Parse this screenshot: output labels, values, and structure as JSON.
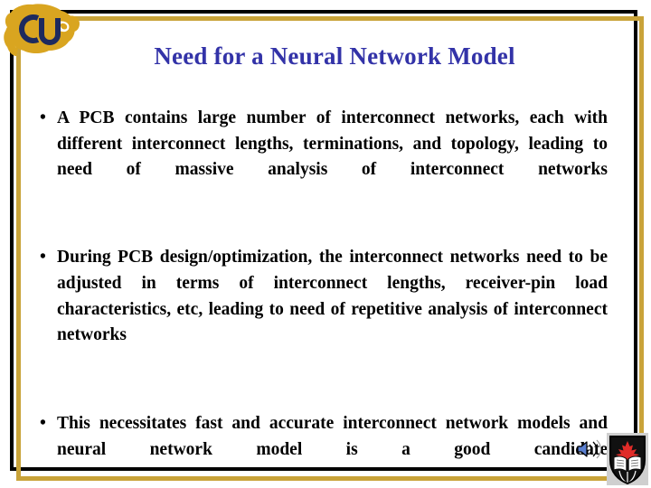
{
  "slide": {
    "title": "Need for a Neural Network Model",
    "title_color": "#3333a8",
    "background_color": "#ffffff",
    "frame_outer_color": "#000000",
    "frame_inner_color": "#c9a339",
    "body_text_color": "#000000",
    "bullet_marker": "•",
    "bullets": [
      "A PCB contains large number of interconnect networks, each with different interconnect lengths, terminations, and topology, leading to need of massive analysis of interconnect networks",
      "During PCB design/optimization, the interconnect networks need to be adjusted in terms of interconnect lengths, receiver-pin load characteristics, etc, leading to need of repetitive analysis of interconnect networks",
      "This necessitates fast and accurate interconnect network models and neural network model is a good candidate"
    ]
  },
  "logo": {
    "name": "cu-buffalo-logo",
    "letters": "CU",
    "buffalo_color": "#d9a520",
    "letters_color": "#1d2a5e"
  },
  "media": {
    "sound_icon": {
      "name": "sound-speaker-icon",
      "color": "#4a6fc9"
    },
    "crest": {
      "name": "university-crest-icon",
      "shield_color": "#111111",
      "leaf_color": "#e02b28",
      "book_color": "#ffffff",
      "plate_color": "#cfcfcf"
    }
  }
}
